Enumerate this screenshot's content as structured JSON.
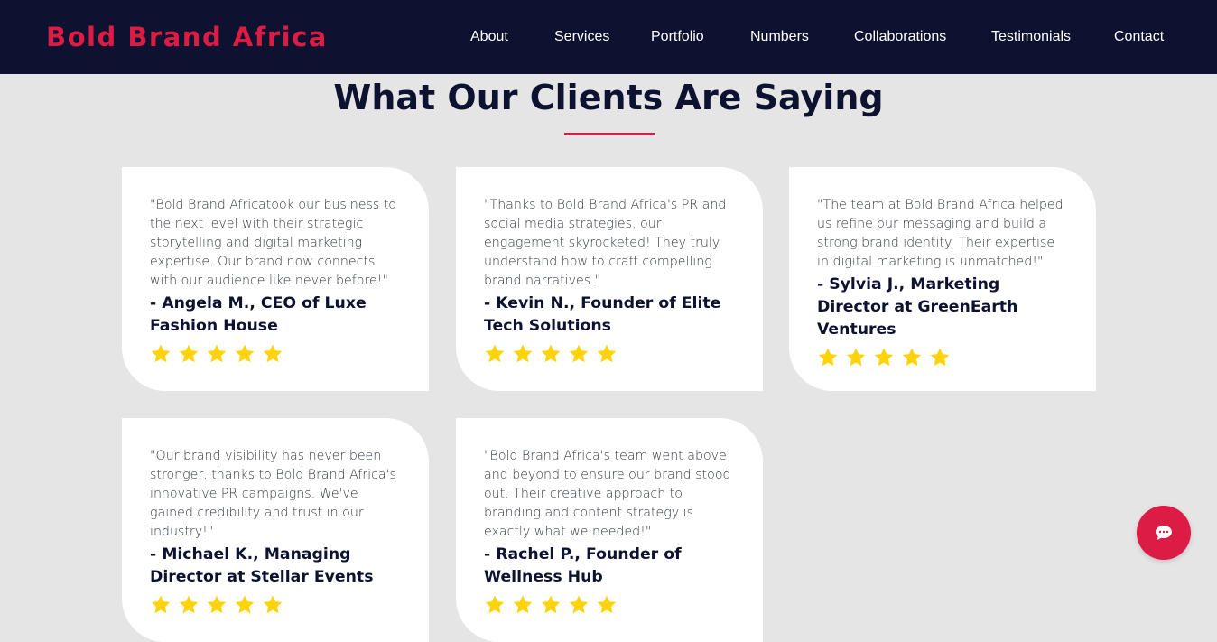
{
  "header": {
    "brand": "Bold Brand Africa",
    "nav": [
      "About",
      "Services",
      "Portfolio",
      "Numbers",
      "Collaborations",
      "Testimonials",
      "Contact"
    ]
  },
  "testimonials": {
    "title": "What Our Clients Are Saying",
    "cards": [
      {
        "quote": "\"Bold Brand Africatook our business to the next level with their strategic storytelling and digital marketing expertise. Our brand now connects with our audience like never before!\"",
        "author": "- Angela M., CEO of Luxe Fashion House",
        "rating": 5
      },
      {
        "quote": "\"Thanks to Bold Brand Africa's PR and social media strategies, our engagement skyrocketed! They truly understand how to craft compelling brand narratives.\"",
        "author": "- Kevin N., Founder of Elite Tech Solutions",
        "rating": 5
      },
      {
        "quote": "\"The team at Bold Brand Africa helped us refine our messaging and build a strong brand identity. Their expertise in digital marketing is unmatched!\"",
        "author": "- Sylvia J., Marketing Director at GreenEarth Ventures",
        "rating": 5
      },
      {
        "quote": "\"Our brand visibility has never been stronger, thanks to Bold Brand Africa's innovative PR campaigns. We've gained credibility and trust in our industry!\"",
        "author": "- Michael K., Managing Director at Stellar Events",
        "rating": 5
      },
      {
        "quote": "\"Bold Brand Africa's team went above and beyond to ensure our brand stood out. Their creative approach to branding and content strategy is exactly what we needed!\"",
        "author": "- Rachel P., Founder of Wellness Hub",
        "rating": 5
      }
    ]
  },
  "colors": {
    "navy": "#0c1230",
    "accent": "#dc1c45",
    "star": "#ffd20a",
    "background": "#e5e5e5"
  },
  "icons": {
    "chat": "chat-bubble-icon",
    "star": "star-icon"
  }
}
